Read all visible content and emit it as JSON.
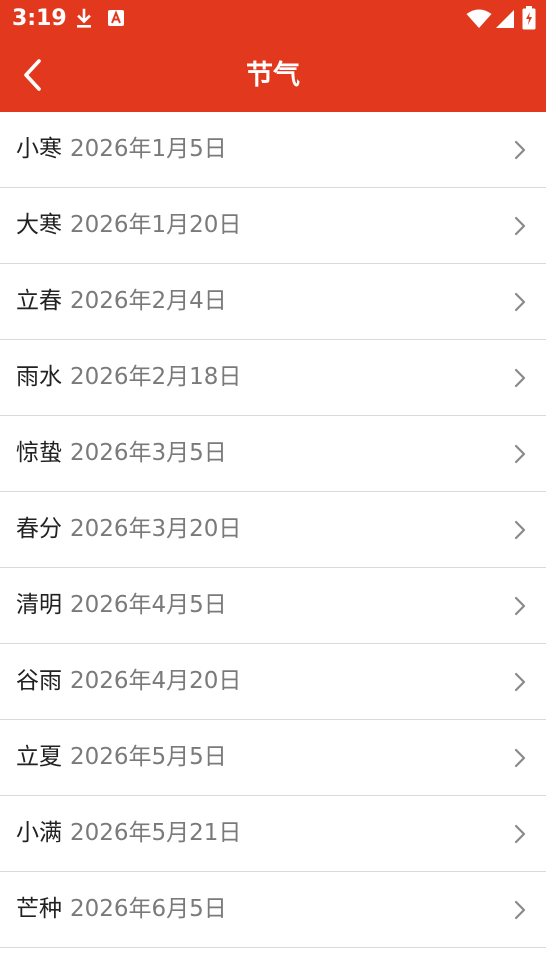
{
  "status_bar": {
    "time": "3:19",
    "icons": [
      "download-icon",
      "a-badge-icon",
      "wifi-icon",
      "signal-icon",
      "battery-charging-icon"
    ]
  },
  "app_bar": {
    "title": "节气",
    "back_icon": "chevron-left-icon",
    "background_color": "#e2391e"
  },
  "terms": [
    {
      "name": "小寒",
      "date": "2026年1月5日"
    },
    {
      "name": "大寒",
      "date": "2026年1月20日"
    },
    {
      "name": "立春",
      "date": "2026年2月4日"
    },
    {
      "name": "雨水",
      "date": "2026年2月18日"
    },
    {
      "name": "惊蛰",
      "date": "2026年3月5日"
    },
    {
      "name": "春分",
      "date": "2026年3月20日"
    },
    {
      "name": "清明",
      "date": "2026年4月5日"
    },
    {
      "name": "谷雨",
      "date": "2026年4月20日"
    },
    {
      "name": "立夏",
      "date": "2026年5月5日"
    },
    {
      "name": "小满",
      "date": "2026年5月21日"
    },
    {
      "name": "芒种",
      "date": "2026年6月5日"
    }
  ],
  "row_icon": "chevron-right-icon"
}
